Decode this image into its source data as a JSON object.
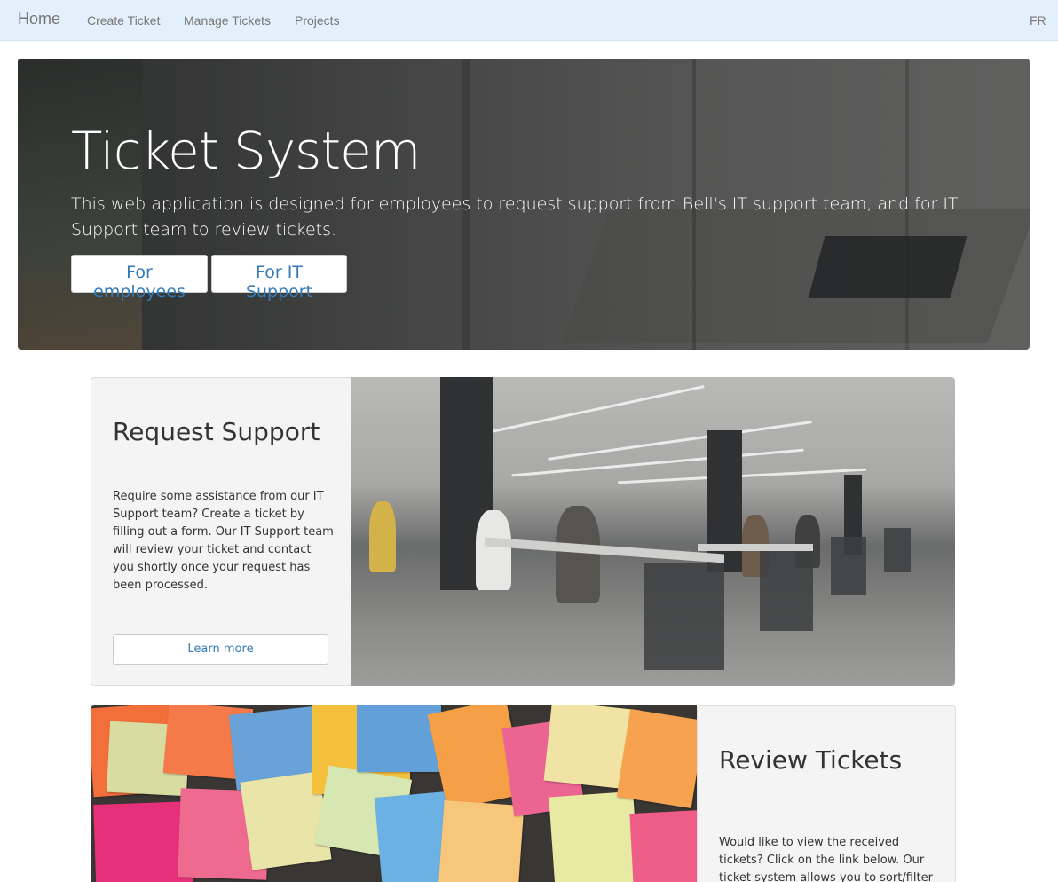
{
  "nav": {
    "brand": "Home",
    "items": [
      "Create Ticket",
      "Manage Tickets",
      "Projects"
    ],
    "language": "FR"
  },
  "hero": {
    "title": "Ticket System",
    "text": "This web application is designed for employees to request support from Bell's IT support team, and for IT Support team to review tickets.",
    "buttons": [
      "For employees",
      "For IT Support"
    ]
  },
  "cards": [
    {
      "title": "Request Support",
      "text": "Require some assistance from our IT Support team? Create a ticket by filling out a form. Our IT Support team will review your ticket and contact you shortly once your request has been processed.",
      "button": "Learn more"
    },
    {
      "title": "Review Tickets",
      "text": "Would like to view the received tickets? Click on the link below. Our ticket system allows you to sort/filter the"
    }
  ],
  "colors": {
    "navbar_bg": "#e3f0fb",
    "link": "#337ab7",
    "card_bg": "#f4f4f4"
  }
}
